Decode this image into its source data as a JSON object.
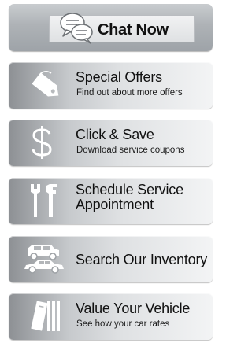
{
  "chat": {
    "label": "Chat Now",
    "icon": "chat-bubbles-icon"
  },
  "panels": [
    {
      "id": "special-offers",
      "title": "Special Offers",
      "subtitle": "Find out about more offers",
      "icon": "price-tag-icon"
    },
    {
      "id": "click-save",
      "title": "Click & Save",
      "subtitle": "Download service coupons",
      "icon": "dollar-sign-icon"
    },
    {
      "id": "schedule-service",
      "title_line1": "Schedule Service",
      "title_line2": "Appointment",
      "icon": "wrench-icon"
    },
    {
      "id": "search-inventory",
      "title": "Search Our Inventory",
      "icon": "cars-icon"
    },
    {
      "id": "value-vehicle",
      "title": "Value Your Vehicle",
      "subtitle": "See how your car rates",
      "icon": "book-icon"
    }
  ],
  "colors": {
    "text": "#111111",
    "panel_light": "#f3f4f5",
    "panel_dark": "#8d9094",
    "icon_fill": "#ffffff"
  }
}
